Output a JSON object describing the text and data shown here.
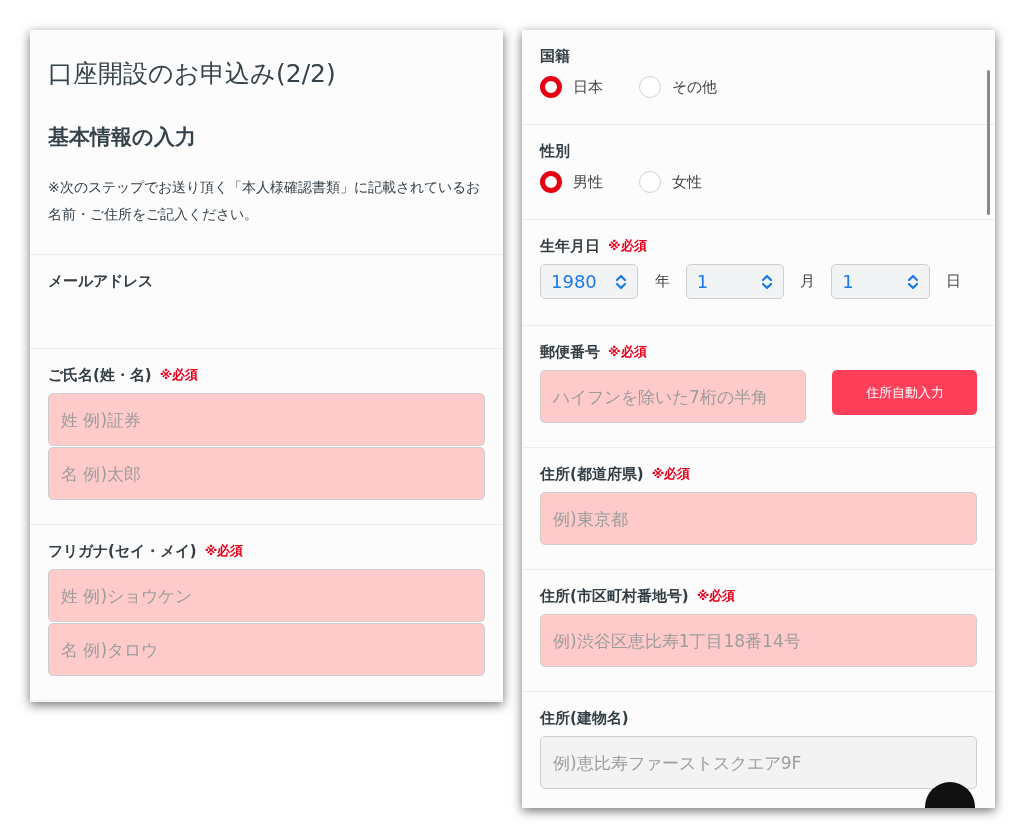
{
  "left_screen": {
    "title": "口座開設のお申込み(2/2)",
    "heading": "基本情報の入力",
    "note": "※次のステップでお送り頂く「本人様確認書類」に記載されているお名前・ご住所をご記入ください。",
    "fields": [
      {
        "kind": "label_only",
        "label": "メールアドレス"
      },
      {
        "kind": "text",
        "label": "ご氏名(姓・名)",
        "required_mark": "※必須",
        "inputs": [
          {
            "placeholder": "姓 例)証券",
            "invalid": true
          },
          {
            "placeholder": "名 例)太郎",
            "invalid": true
          }
        ]
      },
      {
        "kind": "text",
        "label": "フリガナ(セイ・メイ)",
        "required_mark": "※必須",
        "inputs": [
          {
            "placeholder": "姓 例)ショウケン",
            "invalid": true
          },
          {
            "placeholder": "名 例)タロウ",
            "invalid": true
          }
        ]
      }
    ]
  },
  "right_screen": {
    "fields": [
      {
        "kind": "radio",
        "label": "国籍",
        "options": [
          {
            "label": "日本",
            "selected": true
          },
          {
            "label": "その他",
            "selected": false
          }
        ]
      },
      {
        "kind": "radio",
        "label": "性別",
        "options": [
          {
            "label": "男性",
            "selected": true
          },
          {
            "label": "女性",
            "selected": false
          }
        ]
      },
      {
        "kind": "date",
        "label": "生年月日",
        "required_mark": "※必須",
        "selects": [
          {
            "value": "1980",
            "unit": "年"
          },
          {
            "value": "1",
            "unit": "月"
          },
          {
            "value": "1",
            "unit": "日"
          }
        ]
      },
      {
        "kind": "postal",
        "label": "郵便番号",
        "required_mark": "※必須",
        "inputs": [
          {
            "placeholder": "ハイフンを除いた7桁の半角",
            "invalid": true
          }
        ],
        "button": "住所自動入力"
      },
      {
        "kind": "text",
        "label": "住所(都道府県)",
        "required_mark": "※必須",
        "inputs": [
          {
            "placeholder": "例)東京都",
            "invalid": true
          }
        ]
      },
      {
        "kind": "text",
        "label": "住所(市区町村番地号)",
        "required_mark": "※必須",
        "inputs": [
          {
            "placeholder": "例)渋谷区恵比寿1丁目18番14号",
            "invalid": true
          }
        ]
      },
      {
        "kind": "text",
        "label": "住所(建物名)",
        "inputs": [
          {
            "placeholder": "例)恵比寿ファーストスクエア9F",
            "invalid": false
          }
        ]
      }
    ]
  }
}
